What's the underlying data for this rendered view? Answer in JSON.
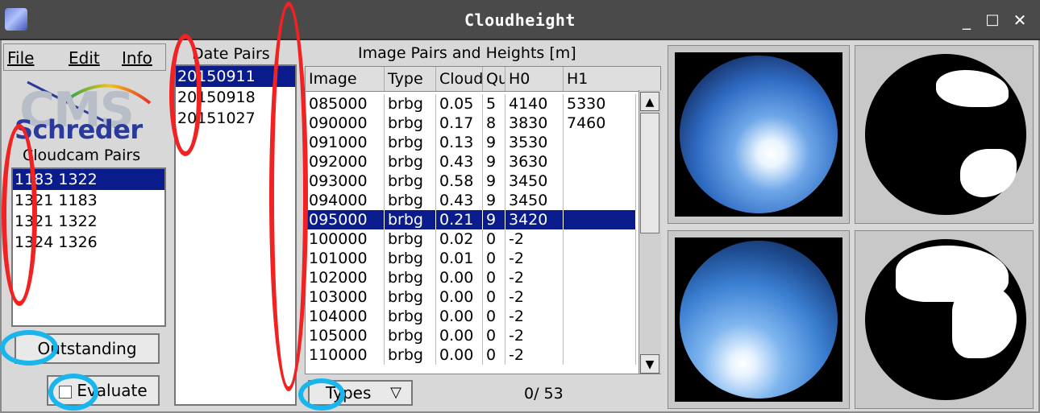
{
  "window": {
    "title": "Cloudheight",
    "controls": [
      "_",
      "□",
      "✕"
    ]
  },
  "menu": {
    "file": "File",
    "edit": "Edit",
    "info": "Info"
  },
  "logo": {
    "top": "CMS",
    "bottom": "Schreder"
  },
  "cloudcam_pairs": {
    "label": "Cloudcam Pairs",
    "items": [
      "1183 1322",
      "1321 1183",
      "1321 1322",
      "1324 1326"
    ],
    "selected_index": 0
  },
  "buttons": {
    "outstanding": "Outstanding",
    "evaluate": "Evaluate",
    "types": "Types"
  },
  "evaluate_checked": false,
  "date_pairs": {
    "label": "Date Pairs",
    "items": [
      "20150911",
      "20150918",
      "20151027"
    ],
    "selected_index": 0
  },
  "image_pairs": {
    "label": "Image Pairs and Heights [m]",
    "columns": [
      "Image",
      "Type",
      "Cloud",
      "Qu",
      "H0",
      "H1"
    ],
    "rows": [
      [
        "085000",
        "brbg",
        "0.05",
        "5",
        "4140",
        "5330"
      ],
      [
        "090000",
        "brbg",
        "0.17",
        "8",
        "3830",
        "7460"
      ],
      [
        "091000",
        "brbg",
        "0.13",
        "9",
        "3530",
        ""
      ],
      [
        "092000",
        "brbg",
        "0.43",
        "9",
        "3630",
        ""
      ],
      [
        "093000",
        "brbg",
        "0.58",
        "9",
        "3450",
        ""
      ],
      [
        "094000",
        "brbg",
        "0.43",
        "9",
        "3450",
        ""
      ],
      [
        "095000",
        "brbg",
        "0.21",
        "9",
        "3420",
        ""
      ],
      [
        "100000",
        "brbg",
        "0.02",
        "0",
        "-2",
        ""
      ],
      [
        "101000",
        "brbg",
        "0.01",
        "0",
        "-2",
        ""
      ],
      [
        "102000",
        "brbg",
        "0.00",
        "0",
        "-2",
        ""
      ],
      [
        "103000",
        "brbg",
        "0.00",
        "0",
        "-2",
        ""
      ],
      [
        "104000",
        "brbg",
        "0.00",
        "0",
        "-2",
        ""
      ],
      [
        "105000",
        "brbg",
        "0.00",
        "0",
        "-2",
        ""
      ],
      [
        "110000",
        "brbg",
        "0.00",
        "0",
        "-2",
        ""
      ]
    ],
    "selected_index": 6
  },
  "counter": "0/ 53",
  "colors": {
    "selection": "#0a1c8c",
    "titlebar": "#4a4a4a",
    "annotation_red": "#f02222",
    "annotation_blue": "#19b6ee"
  }
}
